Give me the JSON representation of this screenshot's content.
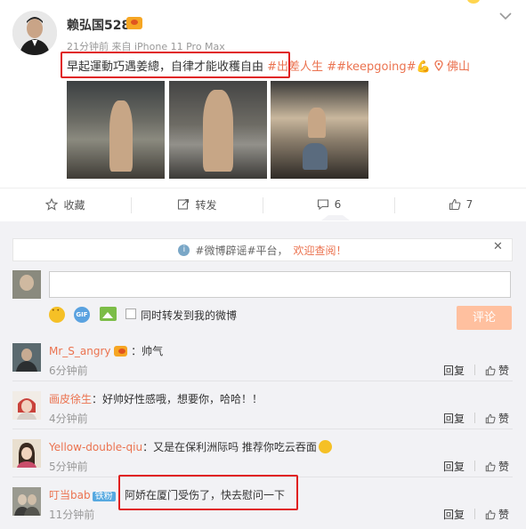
{
  "post": {
    "username": "赖弘国528",
    "meta": "21分钟前 来自 iPhone 11 Pro Max",
    "text": "早起運動巧遇姜總，自律才能收穫自由",
    "topic1": "#出差人生",
    "topic2": "##keepgoing",
    "topic2_end": "#",
    "location": "佛山"
  },
  "actions": {
    "favorite": "收藏",
    "repost": "转发",
    "comment_count": "6",
    "like_count": "7"
  },
  "notice": {
    "text": "#微博辟谣#平台，",
    "link": "欢迎查阅！"
  },
  "composer": {
    "placeholder": "",
    "repost_label": "同时转发到我的微博",
    "submit_label": "评论"
  },
  "comment_ui": {
    "reply": "回复",
    "like": "赞"
  },
  "comments": [
    {
      "name": "Mr_S_angry",
      "text": "：帅气",
      "time": "6分钟前"
    },
    {
      "name": "画皮徐生",
      "text": "：好帅好性感哦，想要你，哈哈！！",
      "time": "4分钟前"
    },
    {
      "name": "Yellow-double-qiu",
      "text": "：又是在保利洲际吗 推荐你吃云吞面",
      "time": "5分钟前"
    },
    {
      "name": "叮当bab",
      "badge": "铁粉",
      "text": "阿娇在厦门受伤了，快去慰问一下",
      "time": "11分钟前"
    }
  ],
  "colors": {
    "accent": "#eb7350",
    "highlight_box": "#e02020",
    "badge": "#57a9e0",
    "panel_bg": "#f2f2f5"
  }
}
